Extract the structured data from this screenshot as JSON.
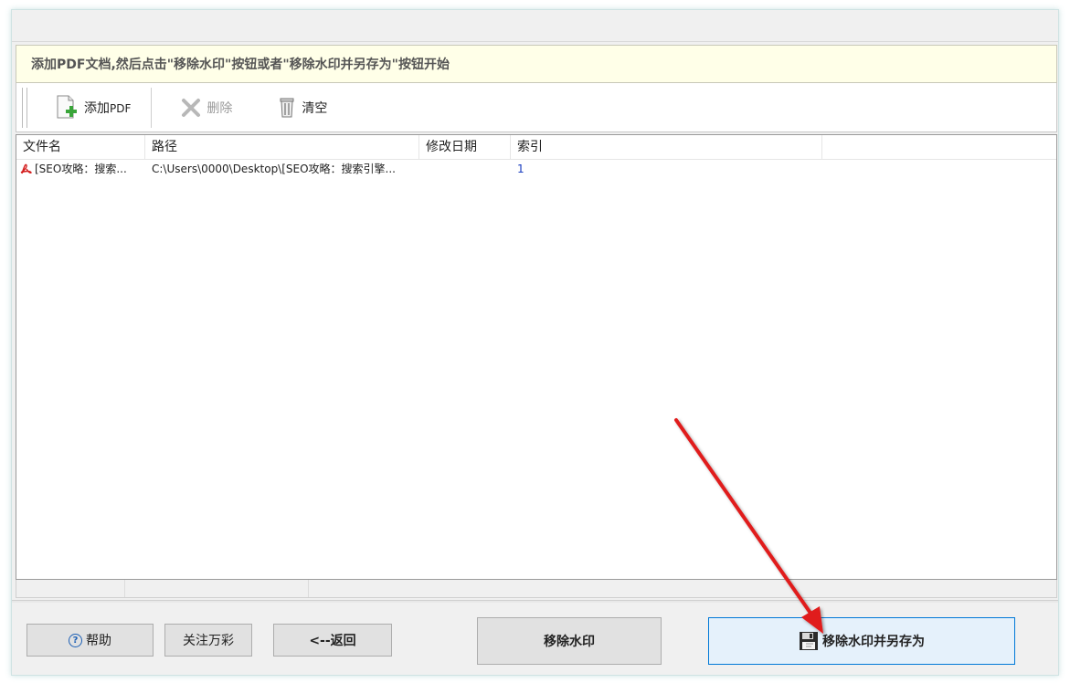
{
  "hint": "添加PDF文档,然后点击\"移除水印\"按钮或者\"移除水印并另存为\"按钮开始",
  "toolbar": {
    "add_prefix": "添加",
    "add_suffix": "PDF",
    "delete": "删除",
    "clear": "清空"
  },
  "table": {
    "headers": [
      "文件名",
      "路径",
      "修改日期",
      "索引"
    ],
    "rows": [
      {
        "name": "[SEO攻略：搜索...",
        "path": "C:\\Users\\0000\\Desktop\\[SEO攻略：搜索引擎...",
        "date": "",
        "index": "1"
      }
    ]
  },
  "buttons": {
    "help": "帮助",
    "follow": "关注万彩",
    "back": "<--返回",
    "remove": "移除水印",
    "remove_save": "移除水印并另存为"
  },
  "colors": {
    "accent": "#0078d7",
    "hint_bg": "#ffffe8",
    "annotation_arrow": "#e01a1a"
  },
  "icons": {
    "add": "add-pdf-icon",
    "delete": "delete-x-icon",
    "clear": "trash-icon",
    "file": "pdf-file-icon",
    "help": "help-circle-icon",
    "save": "save-disk-icon"
  }
}
